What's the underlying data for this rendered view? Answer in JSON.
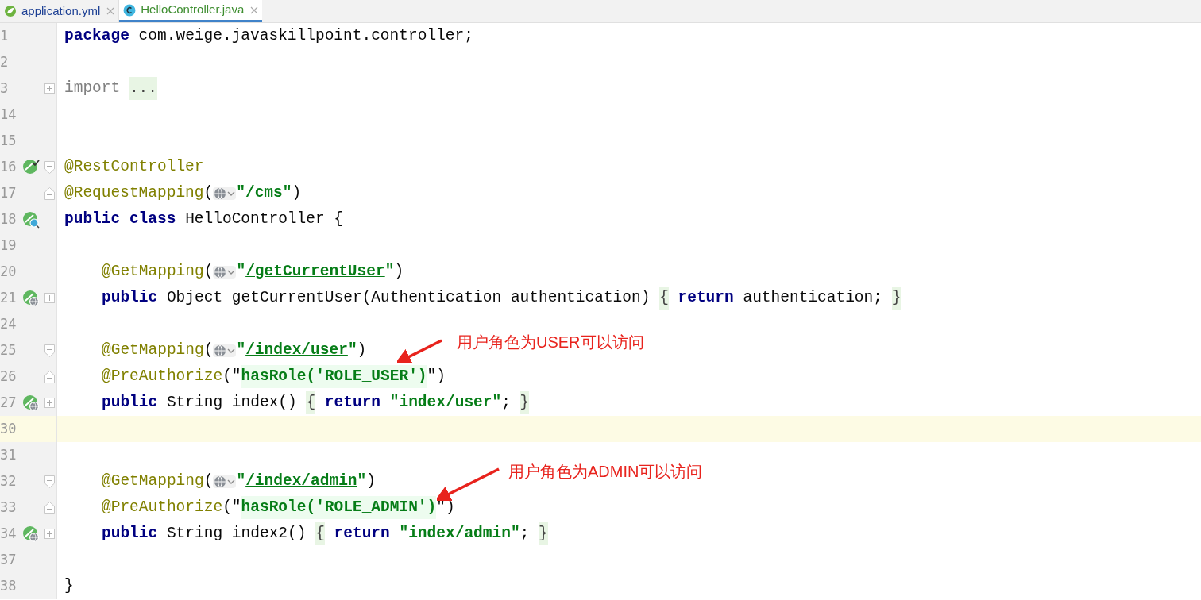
{
  "tabs": [
    {
      "label": "application.yml",
      "selected": false
    },
    {
      "label": "HelloController.java",
      "selected": true
    }
  ],
  "lines": [
    {
      "number": "1",
      "current": false,
      "indented": false,
      "tokens": [
        {
          "kind": "keyword",
          "text": "package"
        },
        {
          "kind": "plain",
          "text": " com.weige.javaskillpoint.controller;"
        }
      ]
    },
    {
      "number": "2",
      "current": false
    },
    {
      "number": "3",
      "current": false,
      "indented": false,
      "fold": {
        "kind": "expand"
      },
      "tokens": [
        {
          "kind": "muted",
          "text": "import "
        },
        {
          "kind": "fold",
          "text": "..."
        }
      ]
    },
    {
      "number": "14",
      "current": false
    },
    {
      "number": "15",
      "current": false
    },
    {
      "number": "16",
      "current": false,
      "indented": false,
      "gutter": {
        "kind": "bean-check"
      },
      "fold": {
        "kind": "start"
      },
      "tokens": [
        {
          "kind": "annotation",
          "text": "@RestController"
        }
      ]
    },
    {
      "number": "17",
      "current": false,
      "indented": false,
      "fold": {
        "kind": "end"
      },
      "tokens": [
        {
          "kind": "annotation",
          "text": "@RequestMapping"
        },
        {
          "kind": "plain",
          "text": "("
        },
        {
          "kind": "globe"
        },
        {
          "kind": "string",
          "text": "\""
        },
        {
          "kind": "link",
          "text": "/cms"
        },
        {
          "kind": "string",
          "text": "\""
        },
        {
          "kind": "plain",
          "text": ")"
        }
      ]
    },
    {
      "number": "18",
      "current": false,
      "indented": false,
      "gutter": {
        "kind": "bean-search"
      },
      "tokens": [
        {
          "kind": "keyword",
          "text": "public class"
        },
        {
          "kind": "plain",
          "text": " HelloController {"
        }
      ]
    },
    {
      "number": "19",
      "current": false
    },
    {
      "number": "20",
      "current": false,
      "indented": true,
      "tokens": [
        {
          "kind": "annotation",
          "text": "@GetMapping"
        },
        {
          "kind": "plain",
          "text": "("
        },
        {
          "kind": "globe"
        },
        {
          "kind": "string",
          "text": "\""
        },
        {
          "kind": "link",
          "text": "/getCurrentUser"
        },
        {
          "kind": "string",
          "text": "\""
        },
        {
          "kind": "plain",
          "text": ")"
        }
      ]
    },
    {
      "number": "21",
      "current": false,
      "indented": true,
      "gutter": {
        "kind": "endpoint"
      },
      "fold": {
        "kind": "expand"
      },
      "tokens": [
        {
          "kind": "keyword",
          "text": "public"
        },
        {
          "kind": "plain",
          "text": " Object getCurrentUser(Authentication authentication) "
        },
        {
          "kind": "fold-open",
          "text": "{"
        },
        {
          "kind": "keyword",
          "text": "return"
        },
        {
          "kind": "plain",
          "text": " authentication; "
        },
        {
          "kind": "fold",
          "text": "}"
        }
      ]
    },
    {
      "number": "24",
      "current": false
    },
    {
      "number": "25",
      "current": false,
      "indented": true,
      "fold": {
        "kind": "start"
      },
      "tokens": [
        {
          "kind": "annotation",
          "text": "@GetMapping"
        },
        {
          "kind": "plain",
          "text": "("
        },
        {
          "kind": "globe"
        },
        {
          "kind": "string",
          "text": "\""
        },
        {
          "kind": "link",
          "text": "/index/user"
        },
        {
          "kind": "string",
          "text": "\""
        },
        {
          "kind": "plain",
          "text": ")"
        }
      ]
    },
    {
      "number": "26",
      "current": false,
      "indented": true,
      "fold": {
        "kind": "end"
      },
      "tokens": [
        {
          "kind": "annotation",
          "text": "@PreAuthorize"
        },
        {
          "kind": "plain",
          "text": "(\""
        },
        {
          "kind": "injected",
          "text": "hasRole('ROLE_USER')"
        },
        {
          "kind": "plain",
          "text": "\")"
        }
      ]
    },
    {
      "number": "27",
      "current": false,
      "indented": true,
      "gutter": {
        "kind": "endpoint"
      },
      "fold": {
        "kind": "expand"
      },
      "tokens": [
        {
          "kind": "keyword",
          "text": "public"
        },
        {
          "kind": "plain",
          "text": " String index() "
        },
        {
          "kind": "fold-open",
          "text": "{"
        },
        {
          "kind": "keyword",
          "text": "return"
        },
        {
          "kind": "string",
          "text": " \"index/user\""
        },
        {
          "kind": "plain",
          "text": "; "
        },
        {
          "kind": "fold",
          "text": "}"
        }
      ]
    },
    {
      "number": "30",
      "current": true
    },
    {
      "number": "31",
      "current": false
    },
    {
      "number": "32",
      "current": false,
      "indented": true,
      "fold": {
        "kind": "start"
      },
      "tokens": [
        {
          "kind": "annotation",
          "text": "@GetMapping"
        },
        {
          "kind": "plain",
          "text": "("
        },
        {
          "kind": "globe"
        },
        {
          "kind": "string",
          "text": "\""
        },
        {
          "kind": "link",
          "text": "/index/admin"
        },
        {
          "kind": "string",
          "text": "\""
        },
        {
          "kind": "plain",
          "text": ")"
        }
      ]
    },
    {
      "number": "33",
      "current": false,
      "indented": true,
      "fold": {
        "kind": "end"
      },
      "tokens": [
        {
          "kind": "annotation",
          "text": "@PreAuthorize"
        },
        {
          "kind": "plain",
          "text": "(\""
        },
        {
          "kind": "injected",
          "text": "hasRole('ROLE_ADMIN')"
        },
        {
          "kind": "plain",
          "text": "\")"
        }
      ]
    },
    {
      "number": "34",
      "current": false,
      "indented": true,
      "gutter": {
        "kind": "endpoint"
      },
      "fold": {
        "kind": "expand"
      },
      "tokens": [
        {
          "kind": "keyword",
          "text": "public"
        },
        {
          "kind": "plain",
          "text": " String index2() "
        },
        {
          "kind": "fold-open",
          "text": "{"
        },
        {
          "kind": "keyword",
          "text": "return"
        },
        {
          "kind": "string",
          "text": " \"index/admin\""
        },
        {
          "kind": "plain",
          "text": "; "
        },
        {
          "kind": "fold",
          "text": "}"
        }
      ]
    },
    {
      "number": "37",
      "current": false
    },
    {
      "number": "38",
      "current": false,
      "indented": false,
      "tokens": [
        {
          "kind": "plain",
          "text": "}"
        }
      ]
    }
  ],
  "callouts": [
    {
      "text": "用户角色为USER可以访问"
    },
    {
      "text": "用户角色为ADMIN可以访问"
    }
  ]
}
